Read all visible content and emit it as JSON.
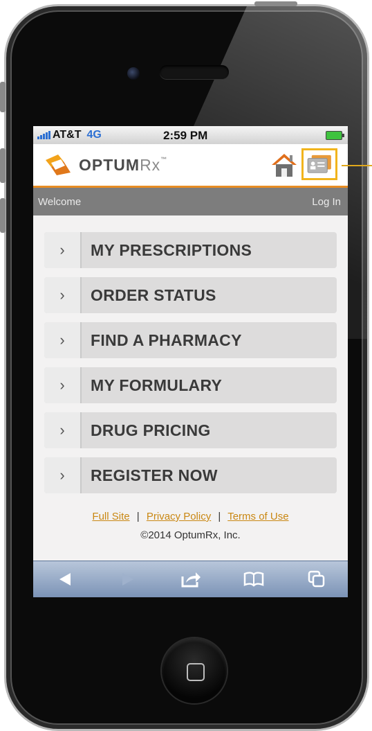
{
  "status_bar": {
    "carrier": "AT&T",
    "network": "4G",
    "time": "2:59 PM"
  },
  "header": {
    "logo_text": "OPTUM",
    "logo_suffix": "Rx",
    "logo_tm": "™",
    "home_icon": "home-icon",
    "card_icon": "id-card-icon"
  },
  "welcome_bar": {
    "welcome": "Welcome",
    "login": "Log In"
  },
  "menu": {
    "items": [
      {
        "label": "MY PRESCRIPTIONS"
      },
      {
        "label": "ORDER STATUS"
      },
      {
        "label": "FIND A PHARMACY"
      },
      {
        "label": "MY FORMULARY"
      },
      {
        "label": "DRUG PRICING"
      },
      {
        "label": "REGISTER NOW"
      }
    ],
    "chevron": "›"
  },
  "footer": {
    "full_site": "Full Site",
    "privacy": "Privacy Policy",
    "terms": "Terms of Use",
    "separator": "|",
    "copyright": "©2014 OptumRx, Inc."
  },
  "colors": {
    "accent_orange": "#e88d23",
    "highlight_yellow": "#f1b41c",
    "welcome_bar": "#7d7d7d",
    "link": "#c98712"
  }
}
